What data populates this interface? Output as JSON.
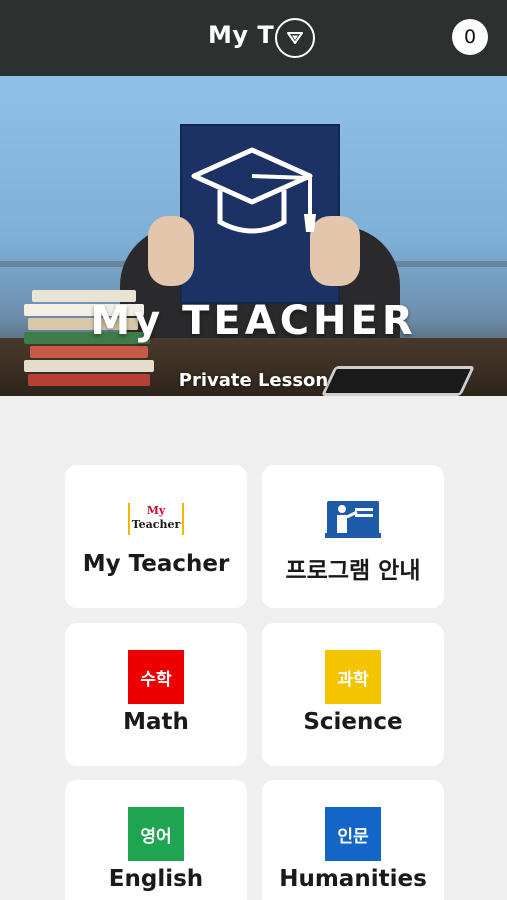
{
  "header": {
    "title": "My T",
    "badge_count": "0"
  },
  "hero": {
    "title": "My TEACHER",
    "subtitle": "Private Lesson"
  },
  "menu": {
    "tiles": [
      {
        "label": "My Teacher",
        "icon": "my-teacher-logo-icon",
        "logo_line1": "My",
        "logo_line2": "Teacher"
      },
      {
        "label": "프로그램 안내",
        "icon": "blackboard-teacher-icon"
      },
      {
        "label": "Math",
        "icon_text": "수학",
        "color": "#ee0000"
      },
      {
        "label": "Science",
        "icon_text": "과학",
        "color": "#f5c400"
      },
      {
        "label": "English",
        "icon_text": "영어",
        "color": "#1fa551"
      },
      {
        "label": "Humanities",
        "icon_text": "인문",
        "color": "#1366c8"
      }
    ]
  },
  "colors": {
    "header_bg": "#2c302e",
    "page_bg": "#efefef",
    "logo_red": "#c8102e",
    "logo_gold": "#f2b700",
    "board_blue": "#1d5aa8"
  }
}
